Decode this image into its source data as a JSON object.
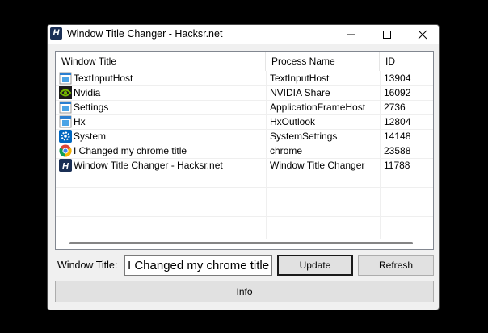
{
  "window": {
    "title": "Window Title Changer - Hacksr.net",
    "app_icon_glyph": "H"
  },
  "colors": {
    "app_icon_bg": "#1a2f55",
    "nvidia_green": "#76b900",
    "settings_blue": "#0067c0",
    "chrome_red": "#db4437",
    "chrome_yellow": "#f4b400",
    "chrome_green": "#0f9d58"
  },
  "listview": {
    "columns": [
      "Window Title",
      "Process Name",
      "ID"
    ],
    "rows": [
      {
        "icon": "generic-app-icon",
        "title": "TextInputHost",
        "process": "TextInputHost",
        "id": "13904"
      },
      {
        "icon": "nvidia-icon",
        "title": "Nvidia",
        "process": "NVIDIA Share",
        "id": "16092"
      },
      {
        "icon": "generic-app-icon",
        "title": "Settings",
        "process": "ApplicationFrameHost",
        "id": "2736"
      },
      {
        "icon": "generic-app-icon",
        "title": "Hx",
        "process": "HxOutlook",
        "id": "12804"
      },
      {
        "icon": "settings-gear-icon",
        "title": "System",
        "process": "SystemSettings",
        "id": "14148"
      },
      {
        "icon": "chrome-icon",
        "title": "I Changed my chrome title",
        "process": "chrome",
        "id": "23588"
      },
      {
        "icon": "hacksr-app-icon",
        "title": "Window Title Changer - Hacksr.net",
        "process": "Window Title Changer",
        "id": "11788"
      }
    ]
  },
  "form": {
    "window_title_label": "Window Title:",
    "window_title_value": "I Changed my chrome title",
    "update_label": "Update",
    "refresh_label": "Refresh",
    "info_label": "Info"
  }
}
